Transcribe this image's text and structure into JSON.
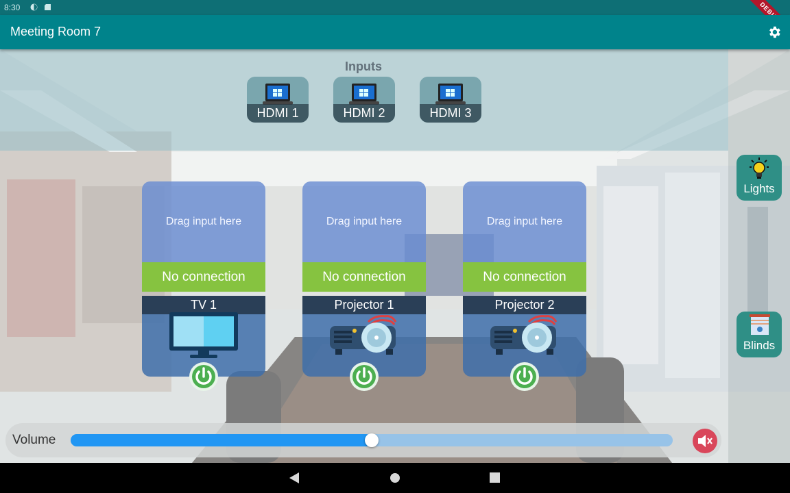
{
  "status_bar": {
    "time": "8:30",
    "debug_label": "DEBUG"
  },
  "app_bar": {
    "title": "Meeting Room 7",
    "settings_icon": "gear-icon"
  },
  "inputs": {
    "title": "Inputs",
    "items": [
      {
        "label": "HDMI 1",
        "icon": "laptop-icon"
      },
      {
        "label": "HDMI 2",
        "icon": "laptop-icon"
      },
      {
        "label": "HDMI 3",
        "icon": "laptop-icon"
      }
    ]
  },
  "devices": [
    {
      "drop_text": "Drag input here",
      "connection": "No connection",
      "name": "TV 1",
      "icon": "tv-icon"
    },
    {
      "drop_text": "Drag input here",
      "connection": "No connection",
      "name": "Projector 1",
      "icon": "projector-icon"
    },
    {
      "drop_text": "Drag input here",
      "connection": "No connection",
      "name": "Projector 2",
      "icon": "projector-icon"
    }
  ],
  "side_buttons": {
    "lights": {
      "label": "Lights",
      "icon": "lightbulb-icon"
    },
    "blinds": {
      "label": "Blinds",
      "icon": "blinds-icon"
    }
  },
  "volume": {
    "label": "Volume",
    "level": 0.5,
    "muted": true,
    "mute_icon": "speaker-mute-icon"
  },
  "colors": {
    "app_bar": "#00838b",
    "connection_bar": "#86c340",
    "volume_fill": "#2196f3",
    "mute_button": "#d9465a",
    "power_button": "#4caf50"
  },
  "nav_bar": {
    "back_icon": "back-triangle-icon",
    "home_icon": "home-circle-icon",
    "recents_icon": "recents-square-icon"
  }
}
